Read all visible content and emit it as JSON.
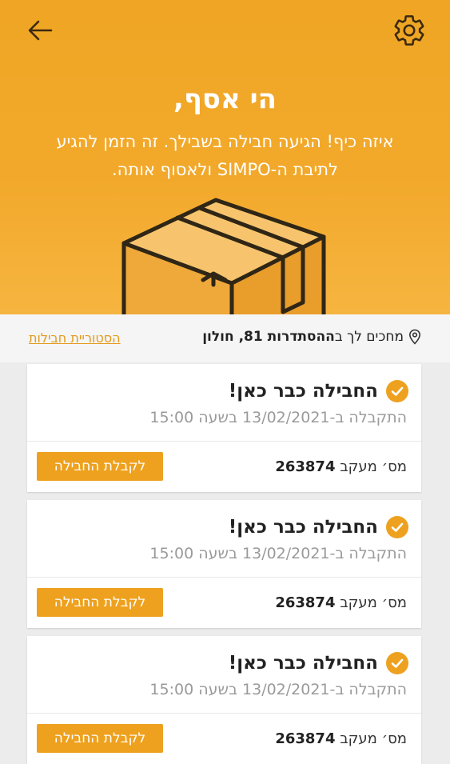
{
  "header": {
    "back_icon": "arrow-left-icon",
    "settings_icon": "gear-icon",
    "greeting": "הי אסף,",
    "message": "איזה כיף! הגיעה חבילה בשבילך. זה הזמן להגיע לתיבת ה-SIMPO ולאסוף אותה.",
    "illustration": "package-box-icon"
  },
  "location": {
    "icon": "location-pin-icon",
    "prefix": "מחכים לך ב",
    "address": "ההסתדרות 81, חולון",
    "history_link": "הסטוריית חבילות"
  },
  "colors": {
    "accent": "#F0A624",
    "button": "#EEA11E",
    "link": "#E49A1C"
  },
  "packages": [
    {
      "title": "החבילה כבר כאן!",
      "received": "התקבלה ב-13/02/2021 בשעה 15:00",
      "tracking_label": "מס׳ מעקב",
      "tracking_number": "263874",
      "button": "לקבלת החבילה"
    },
    {
      "title": "החבילה כבר כאן!",
      "received": "התקבלה ב-13/02/2021 בשעה 15:00",
      "tracking_label": "מס׳ מעקב",
      "tracking_number": "263874",
      "button": "לקבלת החבילה"
    },
    {
      "title": "החבילה כבר כאן!",
      "received": "התקבלה ב-13/02/2021 בשעה 15:00",
      "tracking_label": "מס׳ מעקב",
      "tracking_number": "263874",
      "button": "לקבלת החבילה"
    }
  ]
}
